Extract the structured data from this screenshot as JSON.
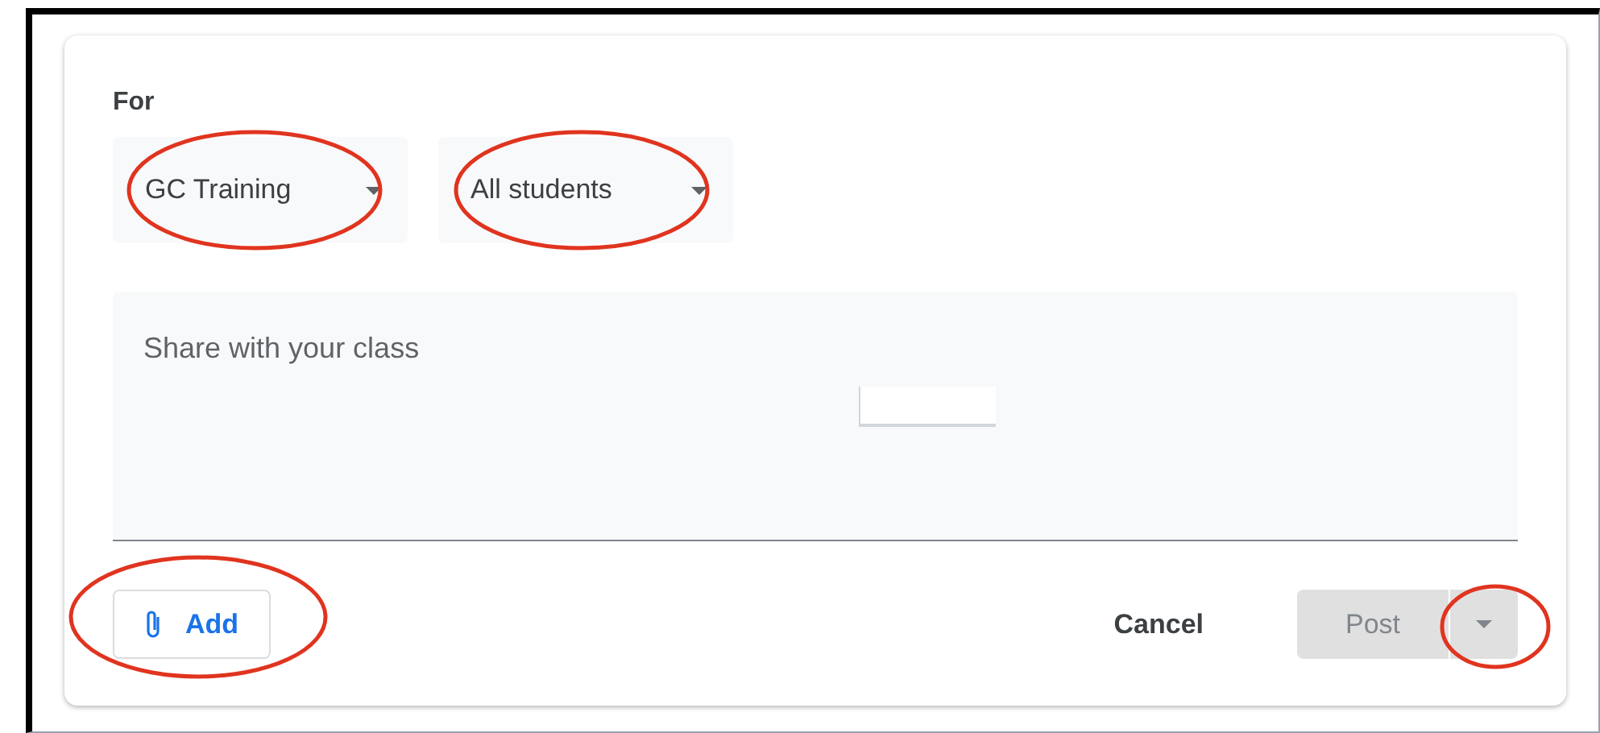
{
  "audience": {
    "label": "For",
    "selects": [
      {
        "value": "GC Training"
      },
      {
        "value": "All students"
      }
    ]
  },
  "composer": {
    "placeholder": "Share with your class"
  },
  "actions": {
    "add": "Add",
    "cancel": "Cancel",
    "post": "Post",
    "post_disabled": true
  }
}
